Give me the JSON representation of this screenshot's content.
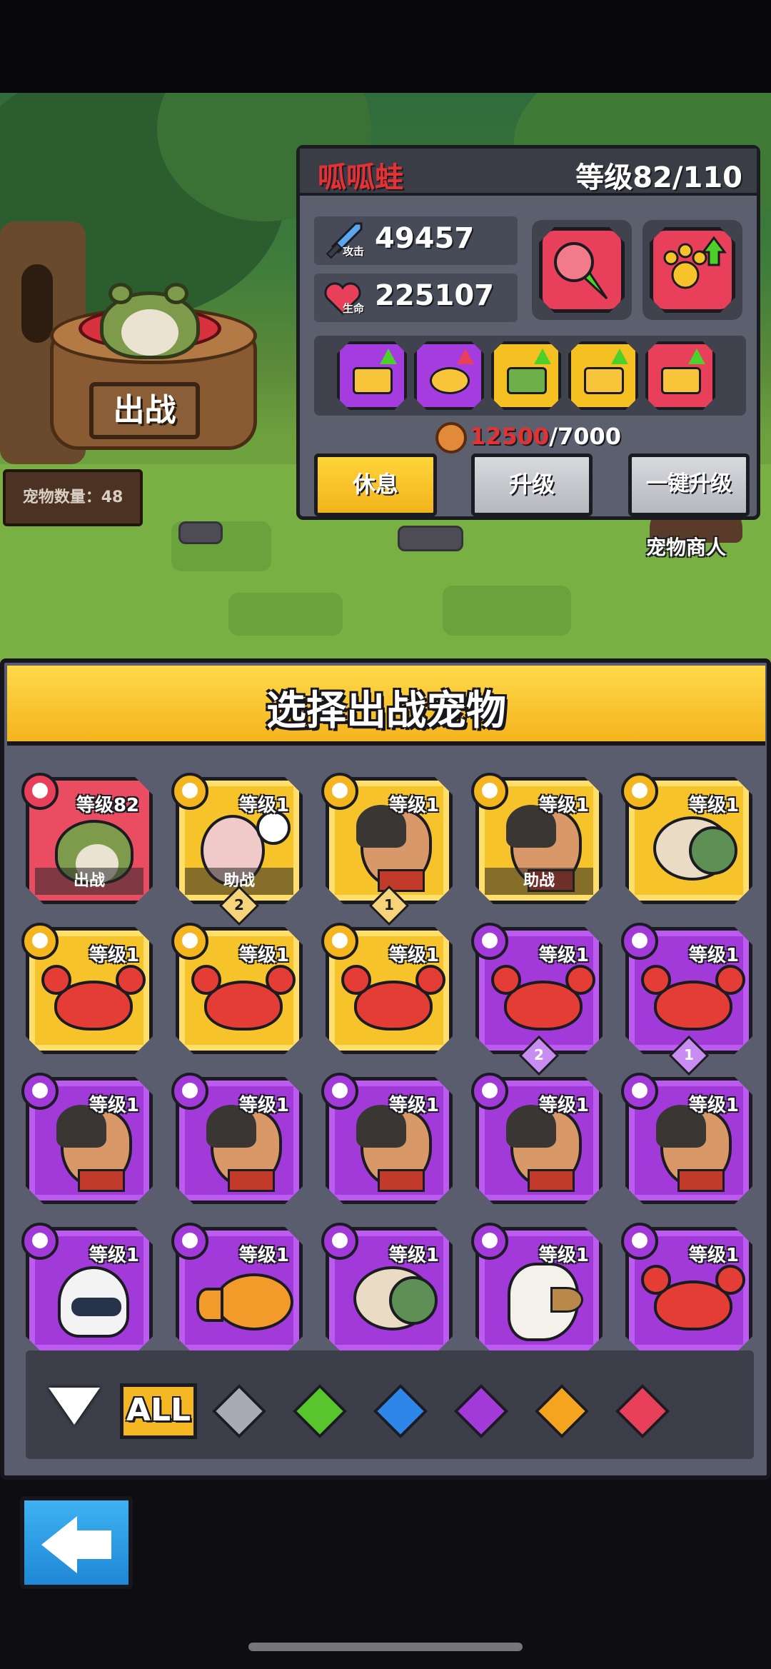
{
  "scene": {
    "battle_sign": "出战",
    "pet_count": "宠物数量：48",
    "merchant_label": "宠物商人"
  },
  "info": {
    "name": "呱呱蛙",
    "level": "等级82/110",
    "attack_value": "49457",
    "attack_tag": "攻击",
    "hp_value": "225107",
    "hp_tag": "生命",
    "cost_have": "12500",
    "cost_need": "/7000",
    "rest_button": "休息",
    "upgrade_button": "升级",
    "oneclick_button": "一键升级",
    "colors": {
      "name": "#e63134",
      "cost_have": "#e63134"
    }
  },
  "select": {
    "title": "选择出战宠物",
    "cards": [
      {
        "pet": "frog",
        "rarity": "red",
        "icon": "coin-stack-icon",
        "level": "等级82",
        "status": "出战",
        "badge": ""
      },
      {
        "pet": "snail",
        "rarity": "gold",
        "icon": "turtle-icon",
        "level": "等级1",
        "status": "助战",
        "badge": "2"
      },
      {
        "pet": "dog",
        "rarity": "gold",
        "icon": "dog-icon",
        "level": "等级1",
        "status": "",
        "badge": "1"
      },
      {
        "pet": "dog",
        "rarity": "gold",
        "icon": "dog-icon",
        "level": "等级1",
        "status": "助战",
        "badge": ""
      },
      {
        "pet": "turtle",
        "rarity": "gold",
        "icon": "turtle-icon",
        "level": "等级1",
        "status": "",
        "badge": ""
      },
      {
        "pet": "crab",
        "rarity": "gold",
        "icon": "eagle-icon",
        "level": "等级1",
        "status": "",
        "badge": ""
      },
      {
        "pet": "crab",
        "rarity": "gold",
        "icon": "eagle-icon",
        "level": "等级1",
        "status": "",
        "badge": ""
      },
      {
        "pet": "crab",
        "rarity": "gold",
        "icon": "eagle-icon",
        "level": "等级1",
        "status": "",
        "badge": ""
      },
      {
        "pet": "crab",
        "rarity": "purple",
        "icon": "eagle-icon",
        "level": "等级1",
        "status": "",
        "badge": "2"
      },
      {
        "pet": "crab",
        "rarity": "purple",
        "icon": "eagle-icon",
        "level": "等级1",
        "status": "",
        "badge": "1"
      },
      {
        "pet": "dog",
        "rarity": "purple",
        "icon": "dog-icon",
        "level": "等级1",
        "status": "",
        "badge": ""
      },
      {
        "pet": "dog",
        "rarity": "purple",
        "icon": "dog-icon",
        "level": "等级1",
        "status": "",
        "badge": ""
      },
      {
        "pet": "dog",
        "rarity": "purple",
        "icon": "dog-icon",
        "level": "等级1",
        "status": "",
        "badge": ""
      },
      {
        "pet": "dog",
        "rarity": "purple",
        "icon": "dog-icon",
        "level": "等级1",
        "status": "",
        "badge": ""
      },
      {
        "pet": "dog",
        "rarity": "purple",
        "icon": "dog-icon",
        "level": "等级1",
        "status": "",
        "badge": ""
      },
      {
        "pet": "robot",
        "rarity": "purple",
        "icon": "dog-icon",
        "level": "等级1",
        "status": "",
        "badge": ""
      },
      {
        "pet": "fish",
        "rarity": "purple",
        "icon": "turtle-icon",
        "level": "等级1",
        "status": "",
        "badge": ""
      },
      {
        "pet": "turtle",
        "rarity": "purple",
        "icon": "turtle-icon",
        "level": "等级1",
        "status": "",
        "badge": ""
      },
      {
        "pet": "eagle",
        "rarity": "purple",
        "icon": "eagle-icon",
        "level": "等级1",
        "status": "",
        "badge": ""
      },
      {
        "pet": "crab",
        "rarity": "purple",
        "icon": "eagle-icon",
        "level": "等级1",
        "status": "",
        "badge": ""
      }
    ]
  },
  "filter": {
    "all_label": "ALL",
    "gems": [
      {
        "name": "gray-gem-icon",
        "color": "#a9abb4"
      },
      {
        "name": "green-gem-icon",
        "color": "#58c42e"
      },
      {
        "name": "blue-gem-icon",
        "color": "#2d86e8"
      },
      {
        "name": "purple-gem-icon",
        "color": "#a23ad9"
      },
      {
        "name": "orange-gem-icon",
        "color": "#f4a41f"
      },
      {
        "name": "red-gem-icon",
        "color": "#e8405a"
      }
    ]
  }
}
